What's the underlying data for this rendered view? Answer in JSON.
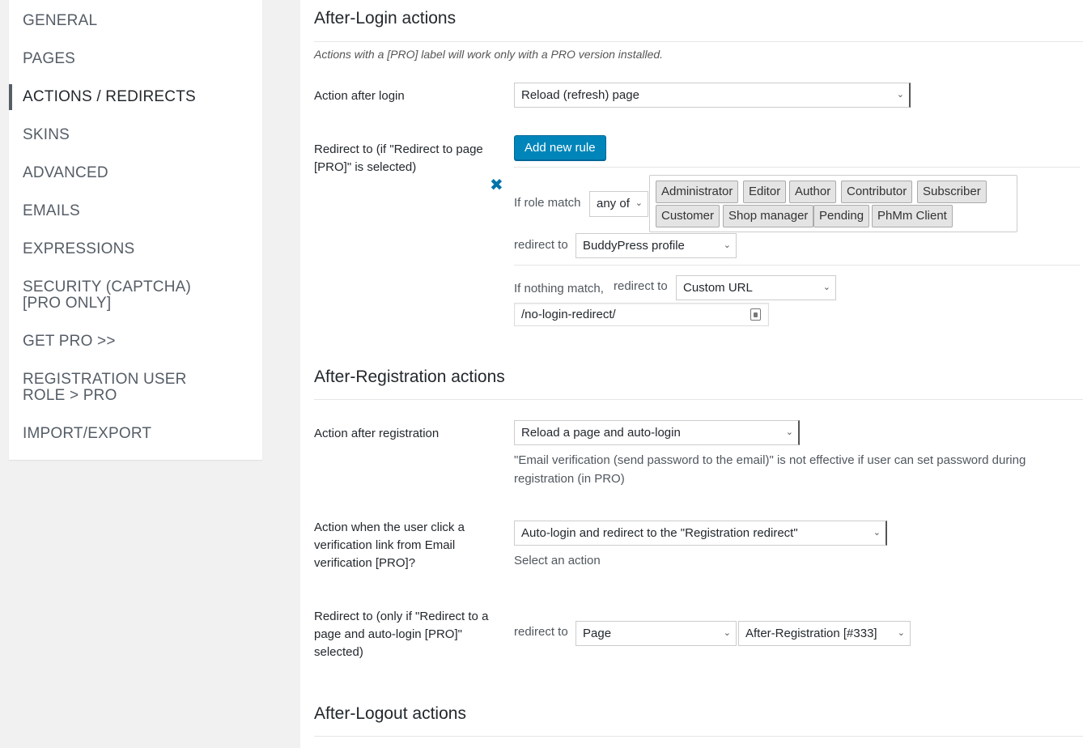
{
  "sidebar": {
    "items": [
      {
        "label": "GENERAL"
      },
      {
        "label": "PAGES"
      },
      {
        "label": "ACTIONS / REDIRECTS"
      },
      {
        "label": "SKINS"
      },
      {
        "label": "ADVANCED"
      },
      {
        "label": "EMAILS"
      },
      {
        "label": "EXPRESSIONS"
      },
      {
        "label": "SECURITY (CAPTCHA) [PRO ONLY]"
      },
      {
        "label": "GET PRO >>"
      },
      {
        "label": "REGISTRATION USER ROLE > PRO"
      },
      {
        "label": "IMPORT/EXPORT"
      }
    ],
    "active_index": 2
  },
  "login": {
    "title": "After-Login actions",
    "note": "Actions with a [PRO] label will work only with a PRO version installed.",
    "action_label": "Action after login",
    "action_value": "Reload (refresh) page",
    "redirect_label": "Redirect to (if \"Redirect to page [PRO]\" is selected)",
    "add_rule": "Add new rule",
    "rule": {
      "role_label": "If role match",
      "match_mode": "any of",
      "roles": [
        "Administrator",
        "Editor",
        "Author",
        "Contributor",
        "Subscriber",
        "Customer",
        "Shop manager",
        "Pending",
        "PhMm Client"
      ],
      "redirect_label": "redirect to",
      "redirect_value": "BuddyPress profile"
    },
    "fallback": {
      "label_a": "If nothing match,",
      "label_b": "redirect to",
      "value": "Custom URL",
      "url": "/no-login-redirect/"
    }
  },
  "registration": {
    "title": "After-Registration actions",
    "action_label": "Action after registration",
    "action_value": "Reload a page and auto-login",
    "action_help": "\"Email verification (send password to the email)\" is not effective if user can set password during registration (in PRO)",
    "verify_label": "Action when the user click a verification link from Email verification [PRO]?",
    "verify_value": "Auto-login and redirect to the \"Registration redirect\"",
    "verify_help": "Select an action",
    "redirect_label": "Redirect to (only if \"Redirect to a page and auto-login [PRO]\" selected)",
    "redirect_to": "redirect to",
    "redirect_type": "Page",
    "redirect_page": "After-Registration [#333]"
  },
  "logout": {
    "title": "After-Logout actions"
  },
  "icons": {
    "chevron": "chevron-down-icon",
    "remove": "remove-icon",
    "password": "password-field-icon"
  },
  "colors": {
    "primary": "#0085ba",
    "remove_icon": "#0073aa"
  }
}
